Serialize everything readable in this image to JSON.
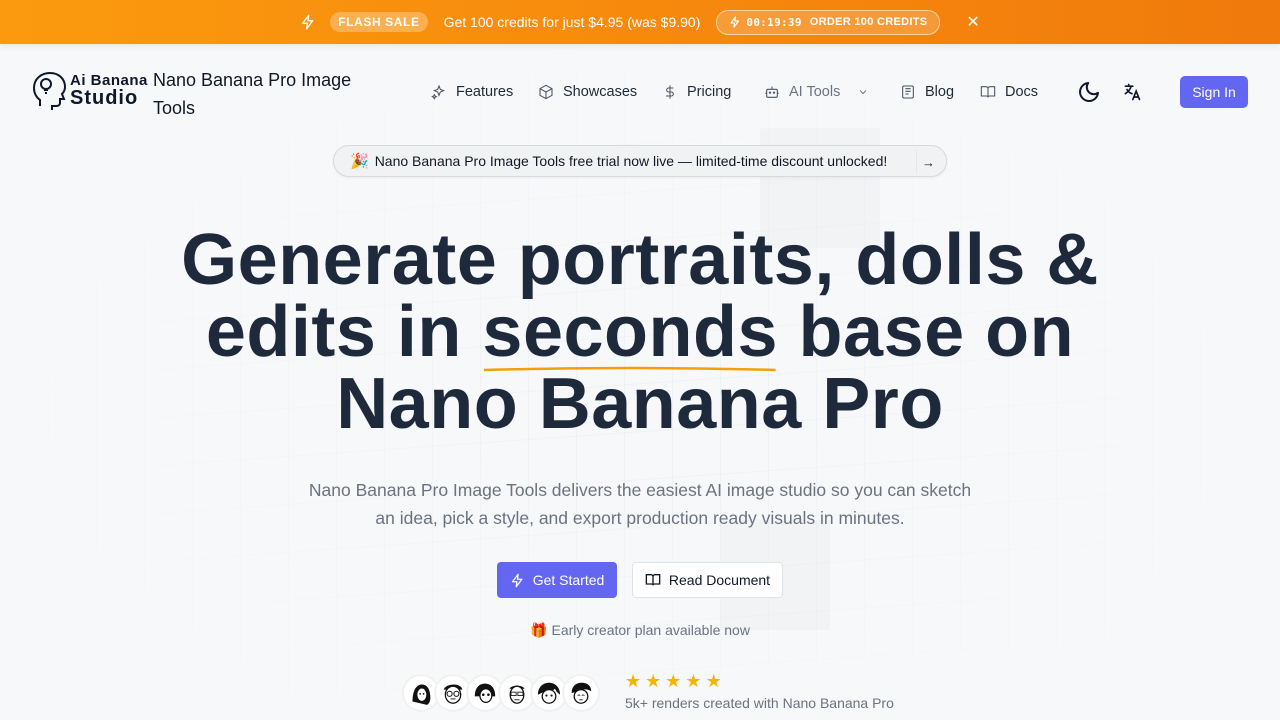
{
  "promo": {
    "badge": "FLASH SALE",
    "message": "Get 100 credits for just $4.95 (was $9.90)",
    "timer": "00:19:39",
    "order_label": "ORDER 100 CREDITS",
    "bolt_icon": "bolt-icon",
    "close_icon": "close-icon"
  },
  "header": {
    "logo_line1": "Ai Banana",
    "logo_line2": "Studio",
    "brand_name": "Nano Banana Pro Image Tools",
    "nav": [
      {
        "label": "Features",
        "icon": "sparkles-icon"
      },
      {
        "label": "Showcases",
        "icon": "cube-icon"
      },
      {
        "label": "Pricing",
        "icon": "dollar-icon"
      },
      {
        "label": "AI Tools",
        "icon": "robot-icon"
      },
      {
        "label": "Blog",
        "icon": "newspaper-icon"
      },
      {
        "label": "Docs",
        "icon": "book-icon"
      }
    ],
    "theme_icon": "moon-icon",
    "language_icon": "translate-icon",
    "sign_in": "Sign In"
  },
  "announcement": {
    "emoji": "🎉",
    "text": "Nano Banana Pro Image Tools free trial now live — limited-time discount unlocked!",
    "arrow": "→"
  },
  "hero": {
    "title_part1": "Generate portraits, dolls & edits in ",
    "title_highlight": "seconds",
    "title_part2": " base on Nano Banana Pro",
    "subtitle": "Nano Banana Pro Image Tools delivers the easiest AI image studio so you can sketch an idea, pick a style, and export production ready visuals in minutes.",
    "primary_cta": "Get Started",
    "secondary_cta": "Read Document",
    "early_emoji": "🎁",
    "early_text": "Early creator plan available now"
  },
  "social_proof": {
    "rating_stars": 5,
    "stars": [
      "★",
      "★",
      "★",
      "★",
      "★"
    ],
    "renders_text": "5k+ renders created with Nano Banana Pro"
  },
  "colors": {
    "accent": "#6366f1",
    "promo_orange": "#f78a0d",
    "highlight_underline": "#f59e0b",
    "star": "#f5b400"
  }
}
